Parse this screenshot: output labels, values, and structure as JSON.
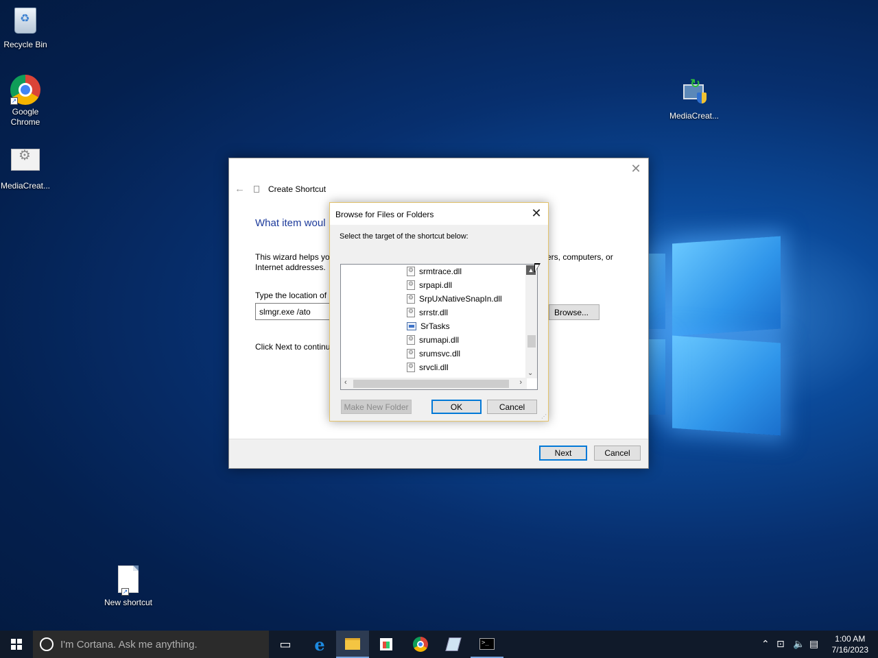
{
  "desktop": {
    "icons": [
      {
        "label": "Recycle Bin",
        "icon": "recycle-bin-icon"
      },
      {
        "label": "Google Chrome",
        "icon": "chrome-icon"
      },
      {
        "label": "MediaCreat...",
        "icon": "media-creation-tool-icon"
      },
      {
        "label": "MediaCreat...",
        "icon": "media-creation-tool-shield-icon"
      },
      {
        "label": "New shortcut",
        "icon": "shortcut-file-icon"
      }
    ]
  },
  "wizard": {
    "title": "Create Shortcut",
    "heading": "What item woul",
    "description_left": "This wizard helps you",
    "description_right": "ers, computers, or",
    "description_line2": "Internet addresses.",
    "location_label": "Type the location of",
    "location_value": "slmgr.exe /ato",
    "browse_label": "Browse...",
    "continue_text": "Click Next to continu",
    "next_label": "Next",
    "cancel_label": "Cancel"
  },
  "browse_dialog": {
    "title": "Browse for Files or Folders",
    "prompt": "Select the target of the shortcut below:",
    "items": [
      {
        "name": "srmtrace.dll",
        "type": "file"
      },
      {
        "name": "srpapi.dll",
        "type": "file"
      },
      {
        "name": "SrpUxNativeSnapIn.dll",
        "type": "file"
      },
      {
        "name": "srrstr.dll",
        "type": "file"
      },
      {
        "name": "SrTasks",
        "type": "app"
      },
      {
        "name": "srumapi.dll",
        "type": "file"
      },
      {
        "name": "srumsvc.dll",
        "type": "file"
      },
      {
        "name": "srvcli.dll",
        "type": "file"
      }
    ],
    "make_folder_label": "Make New Folder",
    "ok_label": "OK",
    "cancel_label": "Cancel"
  },
  "taskbar": {
    "search_placeholder": "I'm Cortana. Ask me anything.",
    "apps": [
      "task-view",
      "edge",
      "file-explorer",
      "store",
      "chrome",
      "notepad",
      "command-prompt"
    ],
    "time": "1:00 AM",
    "date": "7/16/2023"
  }
}
